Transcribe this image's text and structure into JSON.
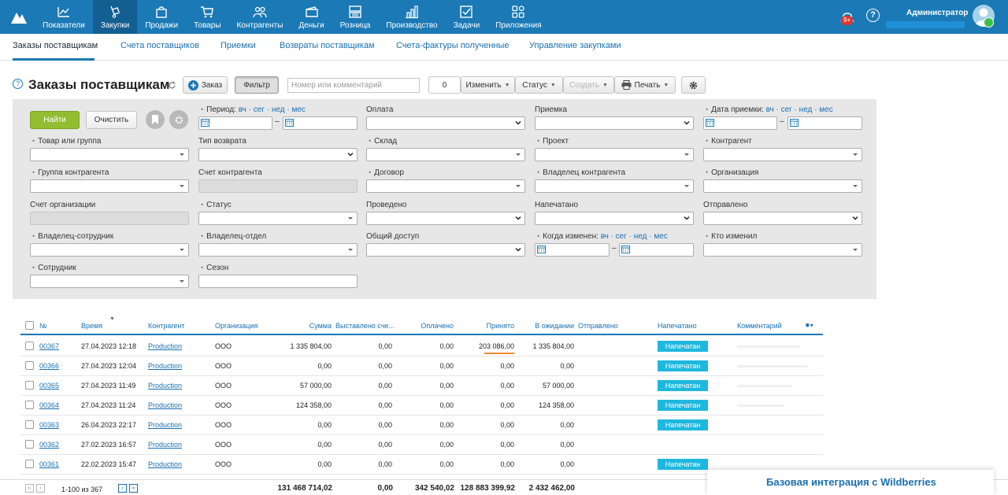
{
  "app": {
    "nav": [
      {
        "label": "Показатели",
        "icon": "chart-line-icon"
      },
      {
        "label": "Закупки",
        "icon": "hand-cart-icon"
      },
      {
        "label": "Продажи",
        "icon": "shopping-bag-icon"
      },
      {
        "label": "Товары",
        "icon": "cart-icon"
      },
      {
        "label": "Контрагенты",
        "icon": "people-icon"
      },
      {
        "label": "Деньги",
        "icon": "wallet-icon"
      },
      {
        "label": "Розница",
        "icon": "cash-register-icon"
      },
      {
        "label": "Производство",
        "icon": "bar-chart-icon"
      },
      {
        "label": "Задачи",
        "icon": "task-check-icon"
      },
      {
        "label": "Приложения",
        "icon": "apps-grid-icon"
      }
    ],
    "active_nav": "Закупки",
    "notifications_badge": "9+",
    "help_glyph": "?",
    "user_name": "Администратор"
  },
  "subnav": {
    "items": [
      "Заказы поставщикам",
      "Счета поставщиков",
      "Приемки",
      "Возвраты поставщикам",
      "Счета-фактуры полученные",
      "Управление закупками"
    ],
    "active": "Заказы поставщикам"
  },
  "header": {
    "title": "Заказы поставщикам",
    "order_button": "Заказ",
    "filter_button": "Фильтр",
    "search_placeholder": "Номер или комментарий",
    "selected_count": "0",
    "change_button": "Изменить",
    "status_button": "Статус",
    "create_button": "Создать",
    "print_button": "Печать"
  },
  "filter": {
    "find_button": "Найти",
    "clear_button": "Очистить",
    "period_label": "Период:",
    "quick_links": "вч · сег · нед · мес",
    "fields": {
      "payment": "Оплата",
      "receipt": "Приемка",
      "receipt_date": "Дата приемки:",
      "product": "Товар или группа",
      "return_type": "Тип возврата",
      "warehouse": "Склад",
      "project": "Проект",
      "counterparty": "Контрагент",
      "counterparty_group": "Группа контрагента",
      "counterparty_account": "Счет контрагента",
      "contract": "Договор",
      "counterparty_owner": "Владелец контрагента",
      "organization": "Организация",
      "org_account": "Счет организации",
      "status": "Статус",
      "posted": "Проведено",
      "printed": "Напечатано",
      "sent": "Отправлено",
      "owner_employee": "Владелец-сотрудник",
      "owner_department": "Владелец-отдел",
      "shared_access": "Общий доступ",
      "changed_when": "Когда изменен:",
      "changed_by": "Кто изменил",
      "employee": "Сотрудник",
      "season": "Сезон"
    }
  },
  "table": {
    "columns": {
      "number": "№",
      "time": "Время",
      "counterparty": "Контрагент",
      "organization": "Организация",
      "sum": "Сумма",
      "invoiced": "Выставлено сче...",
      "paid": "Оплачено",
      "accepted": "Принято",
      "awaiting": "В ожидании",
      "sent": "Отправлено",
      "printed": "Напечатано",
      "comment": "Комментарий"
    },
    "rows": [
      {
        "number": "00367",
        "time": "27.04.2023 12:18",
        "counterparty": "Production",
        "organization": "ООО",
        "sum": "1 335 804,00",
        "invoiced": "0,00",
        "paid": "0,00",
        "accepted": "203 086,00",
        "awaiting": "1 335 804,00",
        "printed": "Напечатан"
      },
      {
        "number": "00366",
        "time": "27.04.2023 12:04",
        "counterparty": "Production",
        "organization": "ООО",
        "sum": "0,00",
        "invoiced": "0,00",
        "paid": "0,00",
        "accepted": "0,00",
        "awaiting": "0,00",
        "printed": "Напечатан"
      },
      {
        "number": "00365",
        "time": "27.04.2023 11:49",
        "counterparty": "Production",
        "organization": "ООО",
        "sum": "57 000,00",
        "invoiced": "0,00",
        "paid": "0,00",
        "accepted": "0,00",
        "awaiting": "57 000,00",
        "printed": "Напечатан"
      },
      {
        "number": "00364",
        "time": "27.04.2023 11:24",
        "counterparty": "Production",
        "organization": "ООО",
        "sum": "124 358,00",
        "invoiced": "0,00",
        "paid": "0,00",
        "accepted": "0,00",
        "awaiting": "124 358,00",
        "printed": "Напечатан"
      },
      {
        "number": "00363",
        "time": "26.04.2023 22:17",
        "counterparty": "Production",
        "organization": "ООО",
        "sum": "0,00",
        "invoiced": "0,00",
        "paid": "0,00",
        "accepted": "0,00",
        "awaiting": "0,00",
        "printed": "Напечатан"
      },
      {
        "number": "00362",
        "time": "27.02.2023 16:57",
        "counterparty": "Production",
        "organization": "ООО",
        "sum": "0,00",
        "invoiced": "0,00",
        "paid": "0,00",
        "accepted": "0,00",
        "awaiting": "0,00",
        "printed": ""
      },
      {
        "number": "00361",
        "time": "22.02.2023 15:47",
        "counterparty": "Production",
        "organization": "ООО",
        "sum": "0,00",
        "invoiced": "0,00",
        "paid": "0,00",
        "accepted": "0,00",
        "awaiting": "0,00",
        "printed": "Напечатан"
      }
    ]
  },
  "footer": {
    "pagination": "1-100 из 367",
    "total_sum": "131 468 714,02",
    "total_invoiced": "0,00",
    "total_paid": "342 540,02",
    "total_accepted": "128 883 399,92",
    "total_awaiting": "2 432 462,00"
  },
  "promo": {
    "text": "Базовая интеграция с Wildberries"
  },
  "colors": {
    "brand": "#1b79b6",
    "accent_green": "#93bd30",
    "badge_cyan": "#1eb8de",
    "notification_red": "#e5352b"
  }
}
